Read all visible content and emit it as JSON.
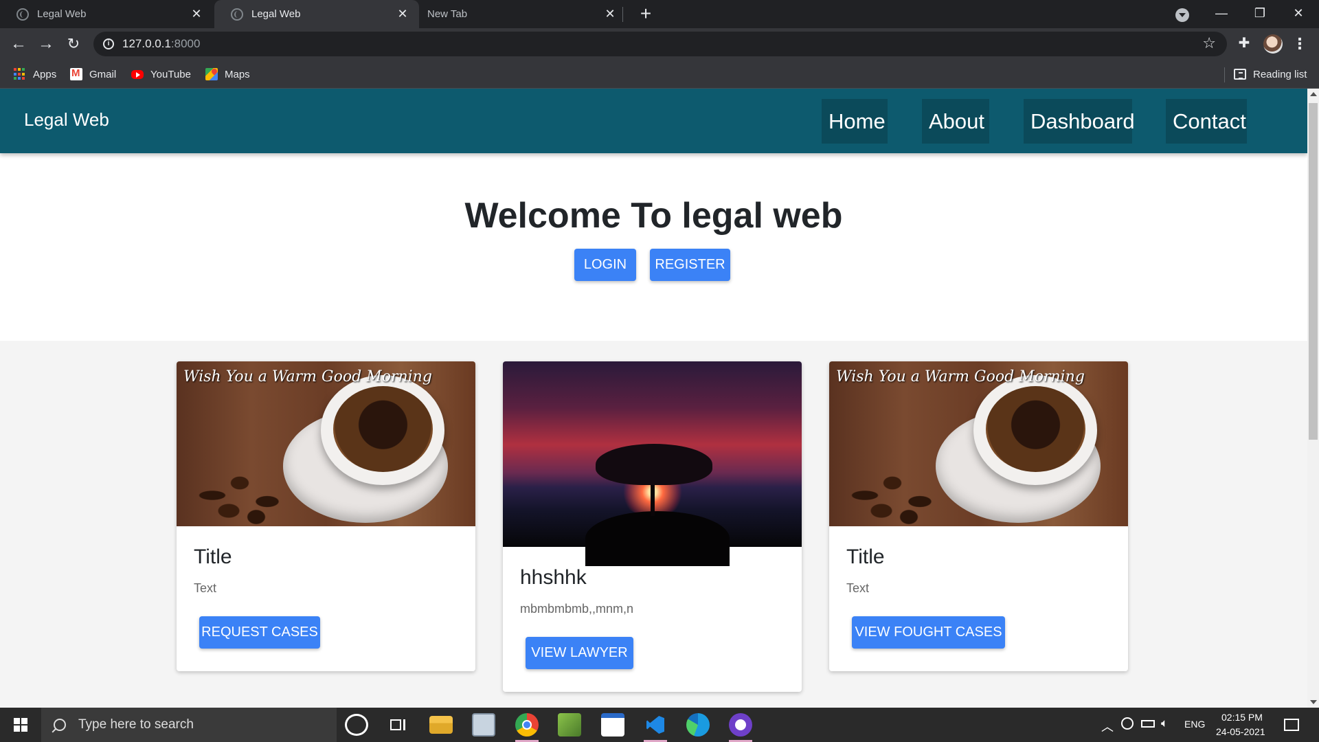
{
  "browser": {
    "tabs": [
      {
        "title": "Legal Web",
        "active": false
      },
      {
        "title": "Legal Web",
        "active": true
      },
      {
        "title": "New Tab",
        "active": false
      }
    ],
    "url_host": "127.0.0.1",
    "url_port": ":8000",
    "bookmarks": [
      "Apps",
      "Gmail",
      "YouTube",
      "Maps"
    ],
    "reading_list": "Reading list"
  },
  "site": {
    "brand": "Legal Web",
    "nav": [
      "Home",
      "About",
      "Dashboard",
      "Contact"
    ],
    "hero_title": "Welcome To legal web",
    "login_label": "LOGIN",
    "register_label": "REGISTER",
    "cards": [
      {
        "title": "Title",
        "text": "Text",
        "button": "REQUEST CASES",
        "image": "coffee-cup-image",
        "image_caption": "Wish You a Warm Good Morning"
      },
      {
        "title": "hhshhk",
        "text": "mbmbmbmb,,mnm,n",
        "button": "VIEW LAWYER",
        "image": "sunset-tree-image"
      },
      {
        "title": "Title",
        "text": "Text",
        "button": "VIEW FOUGHT CASES",
        "image": "coffee-cup-image",
        "image_caption": "Wish You a Warm Good Morning"
      }
    ],
    "colors": {
      "navbar": "#0d5a6e",
      "nav_link_bg": "#0b4a5a",
      "button": "#3b82f6",
      "cards_section_bg": "#f4f4f4"
    }
  },
  "taskbar": {
    "search_placeholder": "Type here to search",
    "apps": [
      "cortana-icon",
      "task-view-icon",
      "file-explorer-icon",
      "photos-icon",
      "chrome-icon",
      "image-editor-icon",
      "window-app-icon",
      "vscode-icon",
      "edge-icon",
      "github-desktop-icon"
    ],
    "language": "ENG",
    "time": "02:15 PM",
    "date": "24-05-2021"
  }
}
